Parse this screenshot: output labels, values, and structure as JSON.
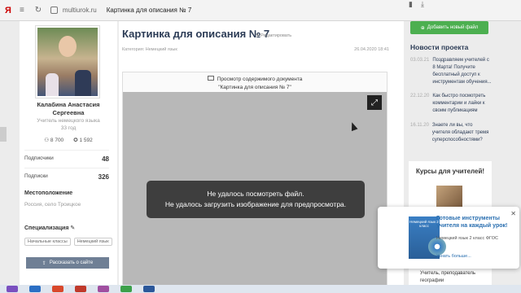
{
  "browser": {
    "logo": "Я",
    "url": "multiurok.ru",
    "tab_title": "Картинка для описания № 7"
  },
  "profile": {
    "name": "Калабина Анастасия Сергеевна",
    "role": "Учитель немецкого языка",
    "city": "33 год",
    "views": "8 700",
    "awards": "1 592",
    "subscribers_label": "Подписчики",
    "subscribers_value": "48",
    "subscriptions_label": "Подписки",
    "subscriptions_value": "326",
    "location_label": "Местоположение",
    "location_value": "Россия, село Троицкое",
    "spec_label": "Специализация",
    "tags": [
      "Начальные классы",
      "Немецкий язык"
    ],
    "share_label": "Рассказать о сайте"
  },
  "document": {
    "title": "Картинка для описания № 7",
    "edit_label": "Редактировать",
    "category": "Категория: Немецкий язык",
    "date": "26.04.2020 18:41",
    "viewer_header_1": "Просмотр содержимого документа",
    "viewer_header_2": "\"Картинка для описания № 7\"",
    "error_1": "Не удалось посмотреть файл.",
    "error_2": "Не удалось загрузить изображение для предпросмотра."
  },
  "right": {
    "add_button": "Добавить новый файл",
    "news_title": "Новости проекта",
    "news": [
      {
        "date": "03.03.21",
        "text": "Поздравляем учителей с 8 Марта! Получите бесплатный доступ к инструментам обучения..."
      },
      {
        "date": "22.12.20",
        "text": "Как быстро посмотреть комментарии и лайки к своим публикациям"
      },
      {
        "date": "16.11.20",
        "text": "Знаете ли вы, что учителя обладают тремя суперспособностями?"
      }
    ],
    "courses_title": "Курсы для учителей!",
    "courses_footer": "Учитель, преподаватель географии"
  },
  "popup": {
    "book_text": "Немецкий язык 2 класс",
    "title": "Готовые инструменты учителя на каждый урок!",
    "subtitle": "Немецкий язык 2 класс ФГОС",
    "link": "Узнать больше..."
  },
  "colors": {
    "accent_green": "#4caf50",
    "title_navy": "#2b3b55",
    "toast_bg": "#3e3e3e"
  }
}
